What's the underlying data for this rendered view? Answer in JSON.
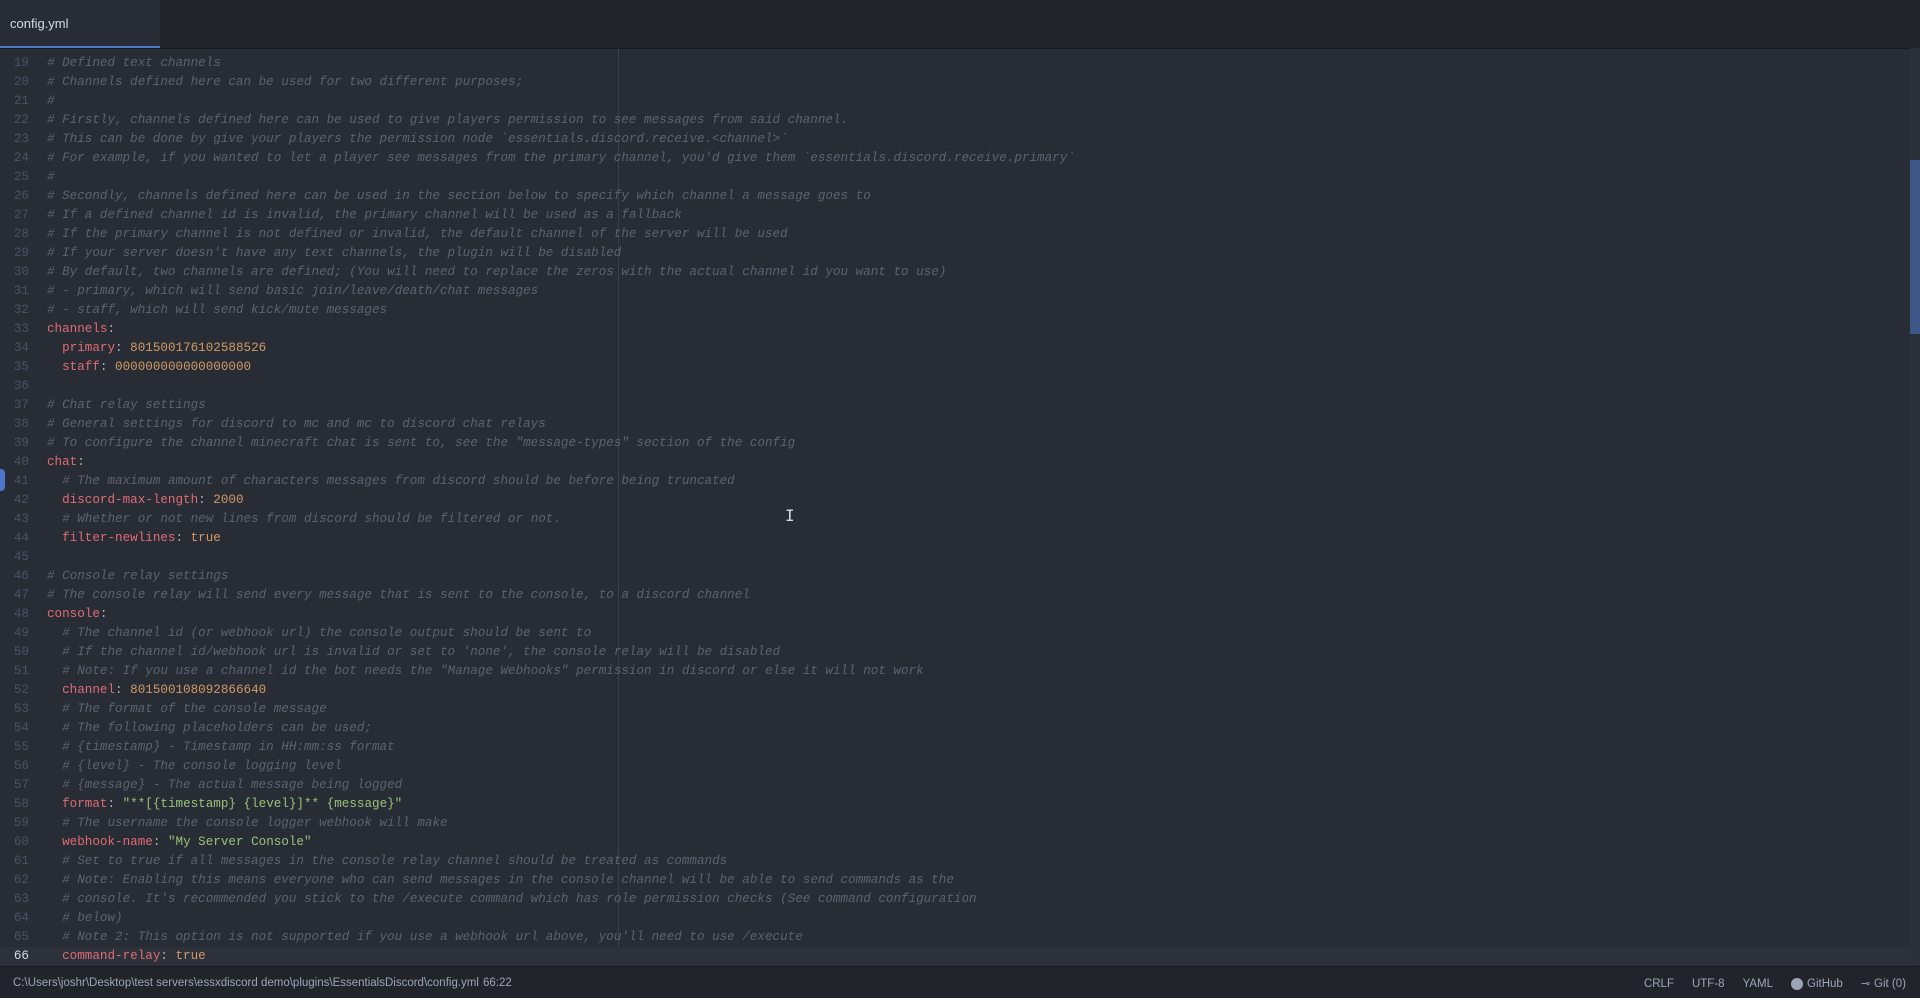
{
  "tab": {
    "label": "config.yml"
  },
  "editor": {
    "cursor_line": 66,
    "lines": [
      {
        "n": "19",
        "segs": [
          [
            "c",
            "# Defined text channels"
          ]
        ]
      },
      {
        "n": "20",
        "segs": [
          [
            "c",
            "# Channels defined here can be used for two different purposes;"
          ]
        ]
      },
      {
        "n": "21",
        "segs": [
          [
            "c",
            "#"
          ]
        ]
      },
      {
        "n": "22",
        "segs": [
          [
            "c",
            "# Firstly, channels defined here can be used to give players permission to see messages from said channel."
          ]
        ]
      },
      {
        "n": "23",
        "segs": [
          [
            "c",
            "# This can be done by give your players the permission node `essentials.discord.receive.<channel>`"
          ]
        ]
      },
      {
        "n": "24",
        "segs": [
          [
            "c",
            "# For example, if you wanted to let a player see messages from the primary channel, you'd give them `essentials.discord.receive.primary`"
          ]
        ]
      },
      {
        "n": "25",
        "segs": [
          [
            "c",
            "#"
          ]
        ]
      },
      {
        "n": "26",
        "segs": [
          [
            "c",
            "# Secondly, channels defined here can be used in the section below to specify which channel a message goes to"
          ]
        ]
      },
      {
        "n": "27",
        "segs": [
          [
            "c",
            "# If a defined channel id is invalid, the primary channel will be used as a fallback"
          ]
        ]
      },
      {
        "n": "28",
        "segs": [
          [
            "c",
            "# If the primary channel is not defined or invalid, the default channel of the server will be used"
          ]
        ]
      },
      {
        "n": "29",
        "segs": [
          [
            "c",
            "# If your server doesn't have any text channels, the plugin will be disabled"
          ]
        ]
      },
      {
        "n": "30",
        "segs": [
          [
            "c",
            "# By default, two channels are defined; (You will need to replace the zeros with the actual channel id you want to use)"
          ]
        ]
      },
      {
        "n": "31",
        "segs": [
          [
            "c",
            "# - primary, which will send basic join/leave/death/chat messages"
          ]
        ]
      },
      {
        "n": "32",
        "segs": [
          [
            "c",
            "# - staff, which will send kick/mute messages"
          ]
        ]
      },
      {
        "n": "33",
        "segs": [
          [
            "k",
            "channels"
          ],
          [
            "p",
            ":"
          ]
        ]
      },
      {
        "n": "34",
        "segs": [
          [
            "p",
            "  "
          ],
          [
            "k",
            "primary"
          ],
          [
            "p",
            ": "
          ],
          [
            "n",
            "801500176102588526"
          ]
        ]
      },
      {
        "n": "35",
        "segs": [
          [
            "p",
            "  "
          ],
          [
            "k",
            "staff"
          ],
          [
            "p",
            ": "
          ],
          [
            "n",
            "000000000000000000"
          ]
        ]
      },
      {
        "n": "36",
        "segs": []
      },
      {
        "n": "37",
        "segs": [
          [
            "c",
            "# Chat relay settings"
          ]
        ]
      },
      {
        "n": "38",
        "segs": [
          [
            "c",
            "# General settings for discord to mc and mc to discord chat relays"
          ]
        ]
      },
      {
        "n": "39",
        "segs": [
          [
            "c",
            "# To configure the channel minecraft chat is sent to, see the \"message-types\" section of the config"
          ]
        ]
      },
      {
        "n": "40",
        "segs": [
          [
            "k",
            "chat"
          ],
          [
            "p",
            ":"
          ]
        ]
      },
      {
        "n": "41",
        "segs": [
          [
            "p",
            "  "
          ],
          [
            "c",
            "# The maximum amount of characters messages from discord should be before being truncated"
          ]
        ]
      },
      {
        "n": "42",
        "segs": [
          [
            "p",
            "  "
          ],
          [
            "k",
            "discord-max-length"
          ],
          [
            "p",
            ": "
          ],
          [
            "n",
            "2000"
          ]
        ]
      },
      {
        "n": "43",
        "segs": [
          [
            "p",
            "  "
          ],
          [
            "c",
            "# Whether or not new lines from discord should be filtered or not."
          ]
        ]
      },
      {
        "n": "44",
        "segs": [
          [
            "p",
            "  "
          ],
          [
            "k",
            "filter-newlines"
          ],
          [
            "p",
            ": "
          ],
          [
            "n",
            "true"
          ]
        ]
      },
      {
        "n": "45",
        "segs": []
      },
      {
        "n": "46",
        "segs": [
          [
            "c",
            "# Console relay settings"
          ]
        ]
      },
      {
        "n": "47",
        "segs": [
          [
            "c",
            "# The console relay will send every message that is sent to the console, to a discord channel"
          ]
        ]
      },
      {
        "n": "48",
        "segs": [
          [
            "k",
            "console"
          ],
          [
            "p",
            ":"
          ]
        ]
      },
      {
        "n": "49",
        "segs": [
          [
            "p",
            "  "
          ],
          [
            "c",
            "# The channel id (or webhook url) the console output should be sent to"
          ]
        ]
      },
      {
        "n": "50",
        "segs": [
          [
            "p",
            "  "
          ],
          [
            "c",
            "# If the channel id/webhook url is invalid or set to 'none', the console relay will be disabled"
          ]
        ]
      },
      {
        "n": "51",
        "segs": [
          [
            "p",
            "  "
          ],
          [
            "c",
            "# Note: If you use a channel id the bot needs the \"Manage Webhooks\" permission in discord or else it will not work"
          ]
        ]
      },
      {
        "n": "52",
        "segs": [
          [
            "p",
            "  "
          ],
          [
            "k",
            "channel"
          ],
          [
            "p",
            ": "
          ],
          [
            "n",
            "801500108092866640"
          ]
        ]
      },
      {
        "n": "53",
        "segs": [
          [
            "p",
            "  "
          ],
          [
            "c",
            "# The format of the console message"
          ]
        ]
      },
      {
        "n": "54",
        "segs": [
          [
            "p",
            "  "
          ],
          [
            "c",
            "# The following placeholders can be used;"
          ]
        ]
      },
      {
        "n": "55",
        "segs": [
          [
            "p",
            "  "
          ],
          [
            "c",
            "# {timestamp} - Timestamp in HH:mm:ss format"
          ]
        ]
      },
      {
        "n": "56",
        "segs": [
          [
            "p",
            "  "
          ],
          [
            "c",
            "# {level} - The console logging level"
          ]
        ]
      },
      {
        "n": "57",
        "segs": [
          [
            "p",
            "  "
          ],
          [
            "c",
            "# {message} - The actual message being logged"
          ]
        ]
      },
      {
        "n": "58",
        "segs": [
          [
            "p",
            "  "
          ],
          [
            "k",
            "format"
          ],
          [
            "p",
            ": "
          ],
          [
            "s",
            "\"**[{timestamp} {level}]** {message}\""
          ]
        ]
      },
      {
        "n": "59",
        "segs": [
          [
            "p",
            "  "
          ],
          [
            "c",
            "# The username the console logger webhook will make"
          ]
        ]
      },
      {
        "n": "60",
        "segs": [
          [
            "p",
            "  "
          ],
          [
            "k",
            "webhook-name"
          ],
          [
            "p",
            ": "
          ],
          [
            "s",
            "\"My Server Console\""
          ]
        ]
      },
      {
        "n": "61",
        "segs": [
          [
            "p",
            "  "
          ],
          [
            "c",
            "# Set to true if all messages in the console relay channel should be treated as commands"
          ]
        ]
      },
      {
        "n": "62",
        "segs": [
          [
            "p",
            "  "
          ],
          [
            "c",
            "# Note: Enabling this means everyone who can send messages in the console channel will be able to send commands as the"
          ]
        ]
      },
      {
        "n": "63",
        "segs": [
          [
            "p",
            "  "
          ],
          [
            "c",
            "# console. It's recommended you stick to the /execute command which has role permission checks (See command configuration"
          ]
        ]
      },
      {
        "n": "64",
        "segs": [
          [
            "p",
            "  "
          ],
          [
            "c",
            "# below)"
          ]
        ]
      },
      {
        "n": "65",
        "segs": [
          [
            "p",
            "  "
          ],
          [
            "c",
            "# Note 2: This option is not supported if you use a webhook url above, you'll need to use /execute"
          ]
        ]
      },
      {
        "n": "66",
        "segs": [
          [
            "p",
            "  "
          ],
          [
            "k",
            "command-relay"
          ],
          [
            "p",
            ": "
          ],
          [
            "n",
            "true"
          ]
        ]
      }
    ]
  },
  "status": {
    "path": "C:\\Users\\joshr\\Desktop\\test servers\\essxdiscord demo\\plugins\\EssentialsDiscord\\config.yml",
    "position": "66:22",
    "line_ending": "CRLF",
    "encoding": "UTF-8",
    "grammar": "YAML",
    "github": "GitHub",
    "git": "Git (0)"
  },
  "colors": {
    "background": "#282c34",
    "comment": "#5c6370",
    "key": "#e06c75",
    "number": "#d19a66",
    "string": "#98c379",
    "accent": "#4d78cc"
  }
}
